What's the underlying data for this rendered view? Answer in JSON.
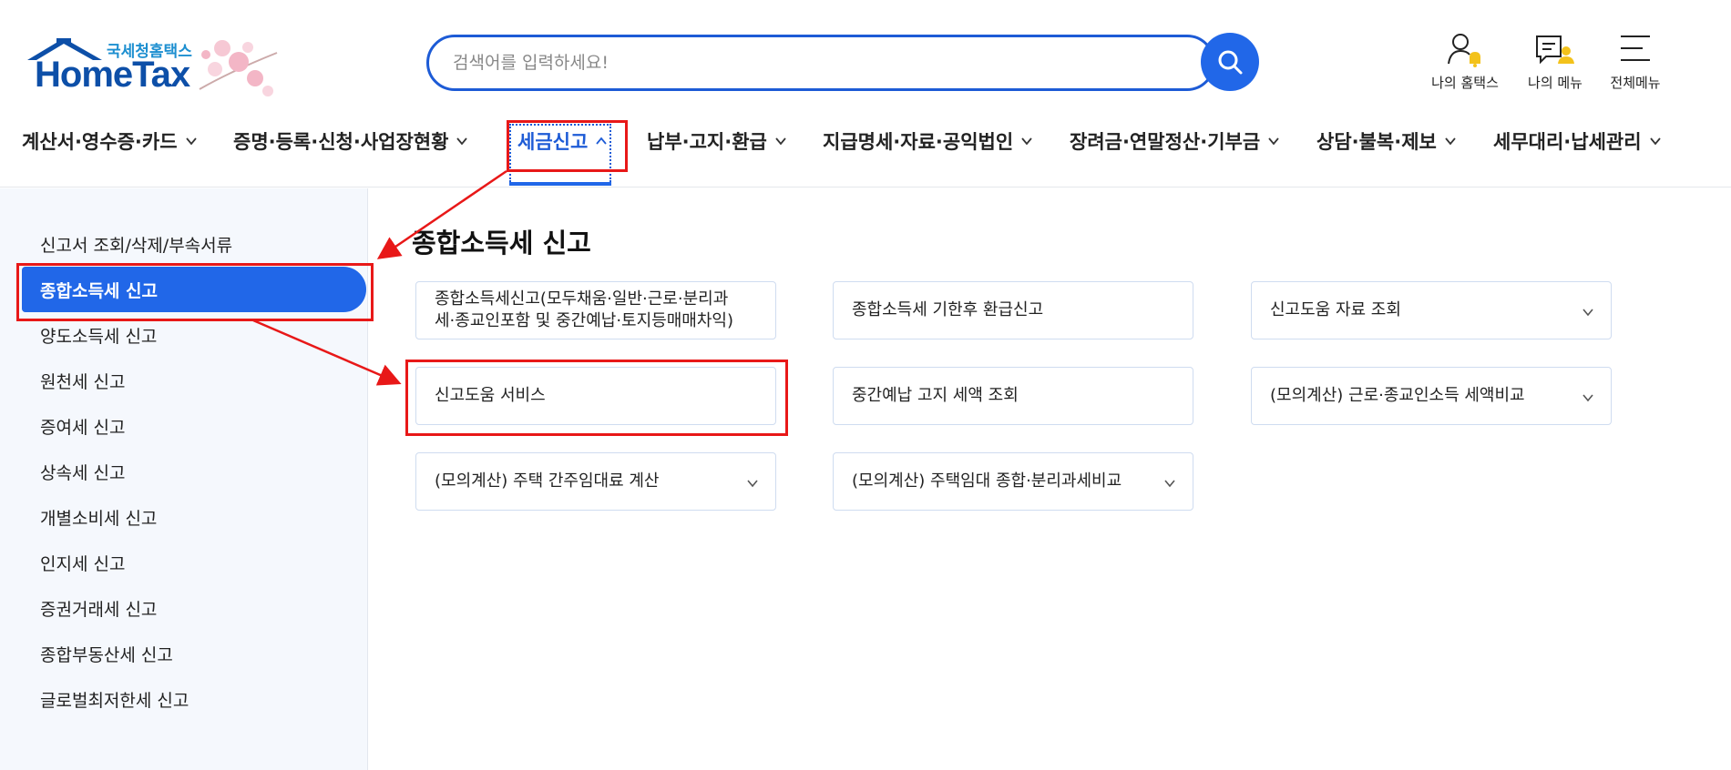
{
  "header": {
    "logo_sub": "국세청홈택스",
    "logo_main": "HomeTax",
    "search": {
      "placeholder": "검색어를 입력하세요!"
    },
    "utils": [
      {
        "label": "나의 홈택스",
        "icon": "user-bell-icon"
      },
      {
        "label": "나의 메뉴",
        "icon": "menu-user-icon"
      },
      {
        "label": "전체메뉴",
        "icon": "hamburger-icon"
      }
    ]
  },
  "gnb": [
    {
      "label": "계산서·영수증·카드"
    },
    {
      "label": "증명·등록·신청·사업장현황"
    },
    {
      "label": "세금신고",
      "active": true
    },
    {
      "label": "납부·고지·환급"
    },
    {
      "label": "지급명세·자료·공익법인"
    },
    {
      "label": "장려금·연말정산·기부금"
    },
    {
      "label": "상담·불복·제보"
    },
    {
      "label": "세무대리·납세관리"
    }
  ],
  "sidebar": {
    "items": [
      {
        "label": "신고서 조회/삭제/부속서류"
      },
      {
        "label": "종합소득세 신고",
        "active": true
      },
      {
        "label": "양도소득세 신고"
      },
      {
        "label": "원천세 신고"
      },
      {
        "label": "증여세 신고"
      },
      {
        "label": "상속세 신고"
      },
      {
        "label": "개별소비세 신고"
      },
      {
        "label": "인지세 신고"
      },
      {
        "label": "증권거래세 신고"
      },
      {
        "label": "종합부동산세 신고"
      },
      {
        "label": "글로벌최저한세 신고"
      }
    ]
  },
  "main": {
    "title": "종합소득세 신고",
    "cards": [
      {
        "label": "종합소득세신고(모두채움·일반·근로·분리과세·종교인포함 및 중간예납·토지등매매차익)",
        "expandable": false
      },
      {
        "label": "종합소득세 기한후 환급신고",
        "expandable": false
      },
      {
        "label": "신고도움 자료 조회",
        "expandable": true
      },
      {
        "label": "신고도움 서비스",
        "expandable": false
      },
      {
        "label": "중간예납 고지 세액 조회",
        "expandable": false
      },
      {
        "label": "(모의계산) 근로·종교인소득 세액비교",
        "expandable": true
      },
      {
        "label": "(모의계산) 주택 간주임대료 계산",
        "expandable": true
      },
      {
        "label": "(모의계산) 주택임대 종합·분리과세비교",
        "expandable": true
      }
    ]
  },
  "colors": {
    "accent": "#2167e8",
    "brand_dark": "#0d4fa8",
    "annotation_red": "#e81818",
    "sidebar_bg": "#f5f8fd",
    "card_border": "#cfdcf0"
  }
}
